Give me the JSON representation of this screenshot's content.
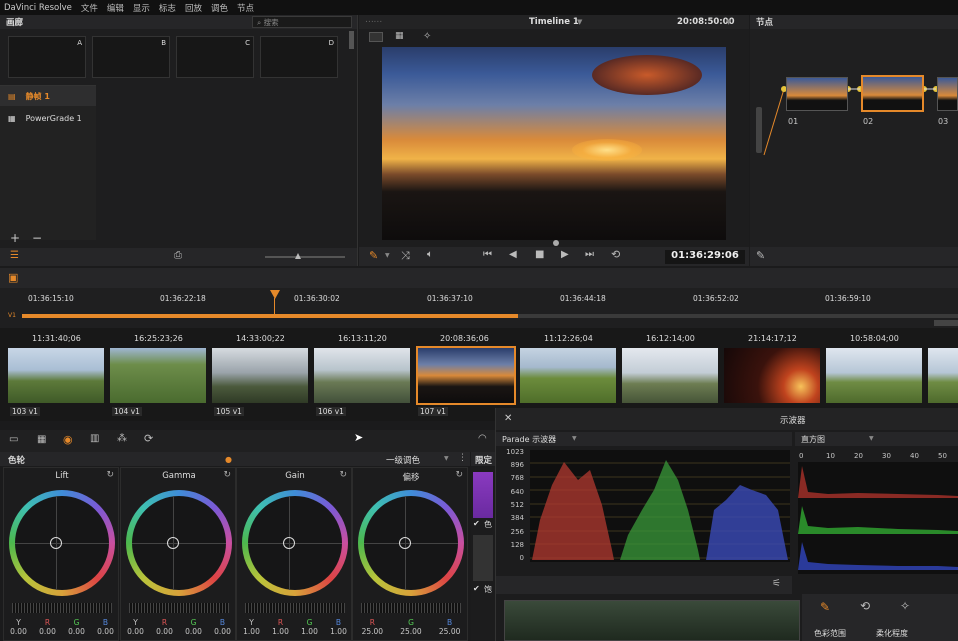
{
  "menu": {
    "app": "DaVinci Resolve",
    "items": [
      "文件",
      "编辑",
      "显示",
      "标志",
      "回放",
      "调色",
      "节点"
    ]
  },
  "gallery": {
    "title": "画廊",
    "search_placeholder": "搜索",
    "slots": [
      "A",
      "B",
      "C",
      "D"
    ],
    "albums": [
      "静帧 1",
      "PowerGrade 1"
    ]
  },
  "viewer": {
    "timeline_name": "Timeline 1",
    "timecode_top": "20:08:50:00",
    "timecode": "01:36:29:06"
  },
  "nodes": {
    "title": "节点",
    "node_labels": [
      "01",
      "02",
      "03"
    ]
  },
  "timeline": {
    "track": "V1",
    "ruler": [
      "01:36:15:10",
      "01:36:22:18",
      "01:36:30:02",
      "01:36:37:10",
      "01:36:44:18",
      "01:36:52:02",
      "01:36:59:10"
    ],
    "clips": [
      {
        "tc": "11:31:40;06",
        "label": "103  v1"
      },
      {
        "tc": "16:25:23;26",
        "label": "104  v1"
      },
      {
        "tc": "14:33:00;22",
        "label": "105  v1"
      },
      {
        "tc": "16:13:11;20",
        "label": "106  v1"
      },
      {
        "tc": "20:08:36;06",
        "label": "107  v1"
      },
      {
        "tc": "11:12:26;04",
        "label": ""
      },
      {
        "tc": "16:12:14;00",
        "label": ""
      },
      {
        "tc": "21:14:17;12",
        "label": ""
      },
      {
        "tc": "10:58:04;00",
        "label": ""
      }
    ]
  },
  "color": {
    "title": "色轮",
    "mode": "一级调色",
    "limit": "限定",
    "wheels": [
      {
        "name": "Lift",
        "vals": [
          "0.00",
          "0.00",
          "0.00",
          "0.00"
        ]
      },
      {
        "name": "Gamma",
        "vals": [
          "0.00",
          "0.00",
          "0.00",
          "0.00"
        ]
      },
      {
        "name": "Gain",
        "vals": [
          "1.00",
          "1.00",
          "1.00",
          "1.00"
        ]
      },
      {
        "name": "偏移",
        "vals": [
          "25.00",
          "25.00",
          "25.00"
        ]
      }
    ],
    "channels": [
      "Y",
      "R",
      "G",
      "B"
    ],
    "side_labels": [
      "色",
      "饱"
    ]
  },
  "scopes": {
    "title": "示波器",
    "parade_label": "Parade 示波器",
    "histo_label": "直方图",
    "y_ticks": [
      "1023",
      "896",
      "768",
      "640",
      "512",
      "384",
      "256",
      "128",
      "0"
    ],
    "histo_ticks": [
      "0",
      "10",
      "20",
      "30",
      "40",
      "50"
    ],
    "bottom_labels": [
      "色彩范围",
      "柔化程度"
    ]
  },
  "colors": {
    "accent": "#e5892a",
    "bg": "#1b1b1c"
  }
}
